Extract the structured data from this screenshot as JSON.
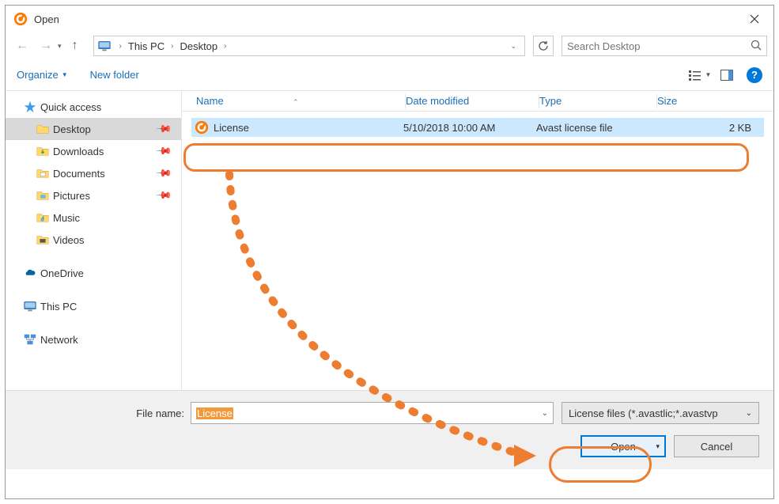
{
  "title_bar": {
    "title": "Open"
  },
  "breadcrumb": {
    "root": "This PC",
    "leaf": "Desktop"
  },
  "search": {
    "placeholder": "Search Desktop"
  },
  "toolbar": {
    "organize": "Organize",
    "new_folder": "New folder"
  },
  "sidebar": {
    "quick_access": "Quick access",
    "desktop": "Desktop",
    "downloads": "Downloads",
    "documents": "Documents",
    "pictures": "Pictures",
    "music": "Music",
    "videos": "Videos",
    "onedrive": "OneDrive",
    "this_pc": "This PC",
    "network": "Network"
  },
  "columns": {
    "name": "Name",
    "date": "Date modified",
    "type": "Type",
    "size": "Size"
  },
  "file": {
    "name": "License",
    "date": "5/10/2018 10:00 AM",
    "type": "Avast license file",
    "size": "2 KB"
  },
  "footer": {
    "label": "File name:",
    "value": "License",
    "filter": "License files (*.avastlic;*.avastvp",
    "open": "Open",
    "cancel": "Cancel"
  },
  "help": "?"
}
